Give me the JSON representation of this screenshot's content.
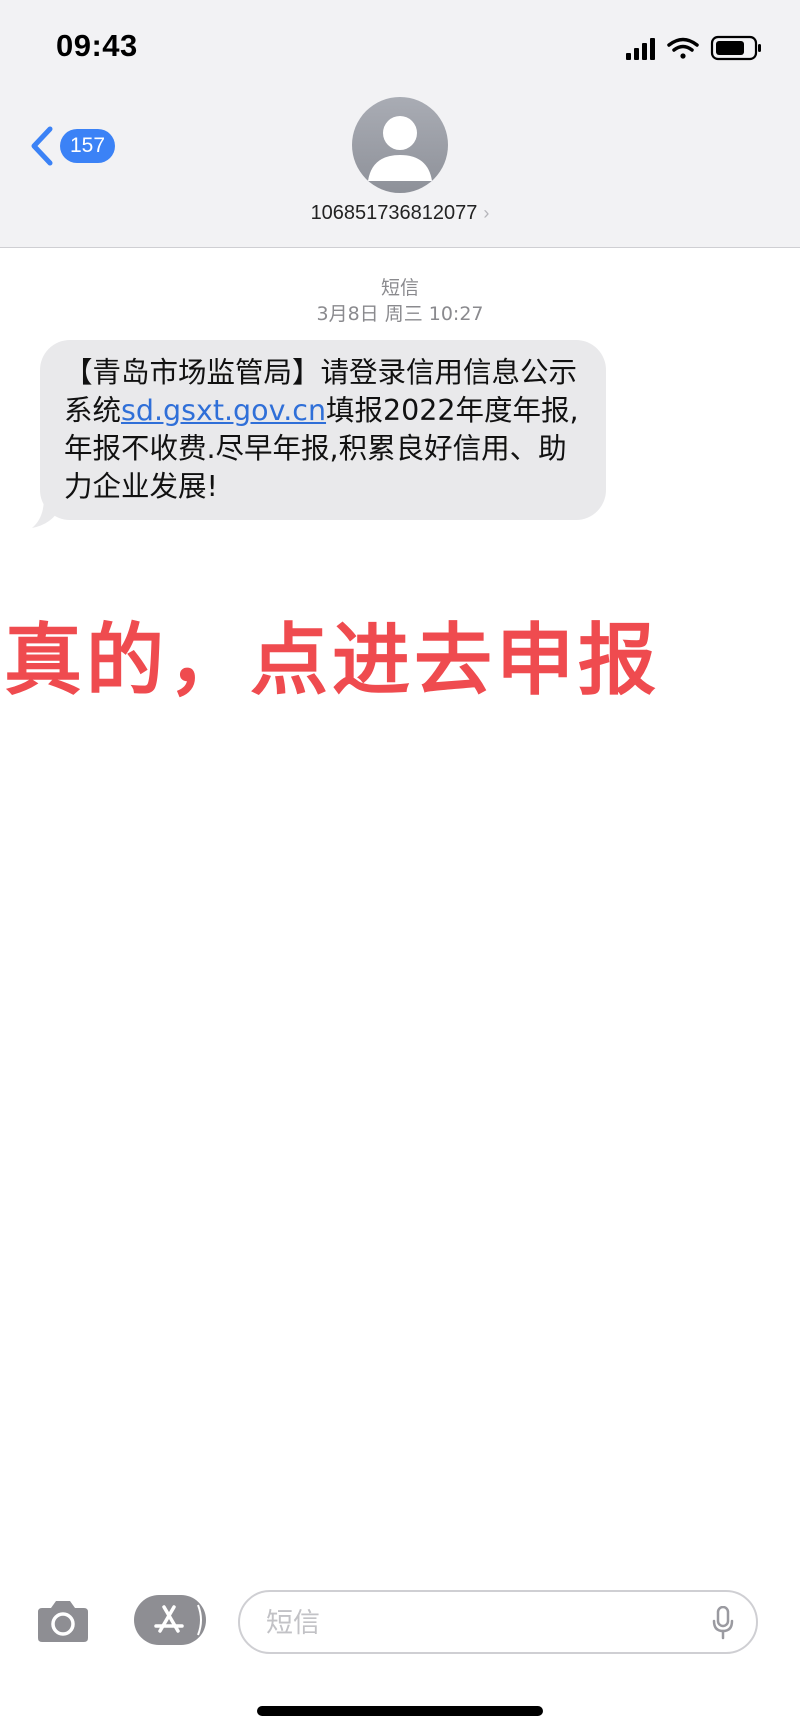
{
  "status_bar": {
    "time": "09:43",
    "icons": [
      "signal-icon",
      "wifi-icon",
      "battery-icon"
    ]
  },
  "nav": {
    "back_badge": "157",
    "contact_number": "106851736812077"
  },
  "thread": {
    "message_type": "短信",
    "timestamp": "3月8日 周三 10:27",
    "message": {
      "text_before_link": "【青岛市场监管局】请登录信用信息公示系统",
      "link": "sd.gsxt.gov.cn",
      "text_after_link": "填报2022年度年报,年报不收费.尽早年报,积累良好信用、助力企业发展!"
    }
  },
  "annotation": "真的，点进去申报",
  "composer": {
    "placeholder": "短信"
  },
  "colors": {
    "header_bg": "#f2f2f4",
    "bubble_bg": "#e9e9eb",
    "link": "#2f6fd8",
    "badge": "#3b82f6",
    "annotation": "#ef4b4f"
  }
}
